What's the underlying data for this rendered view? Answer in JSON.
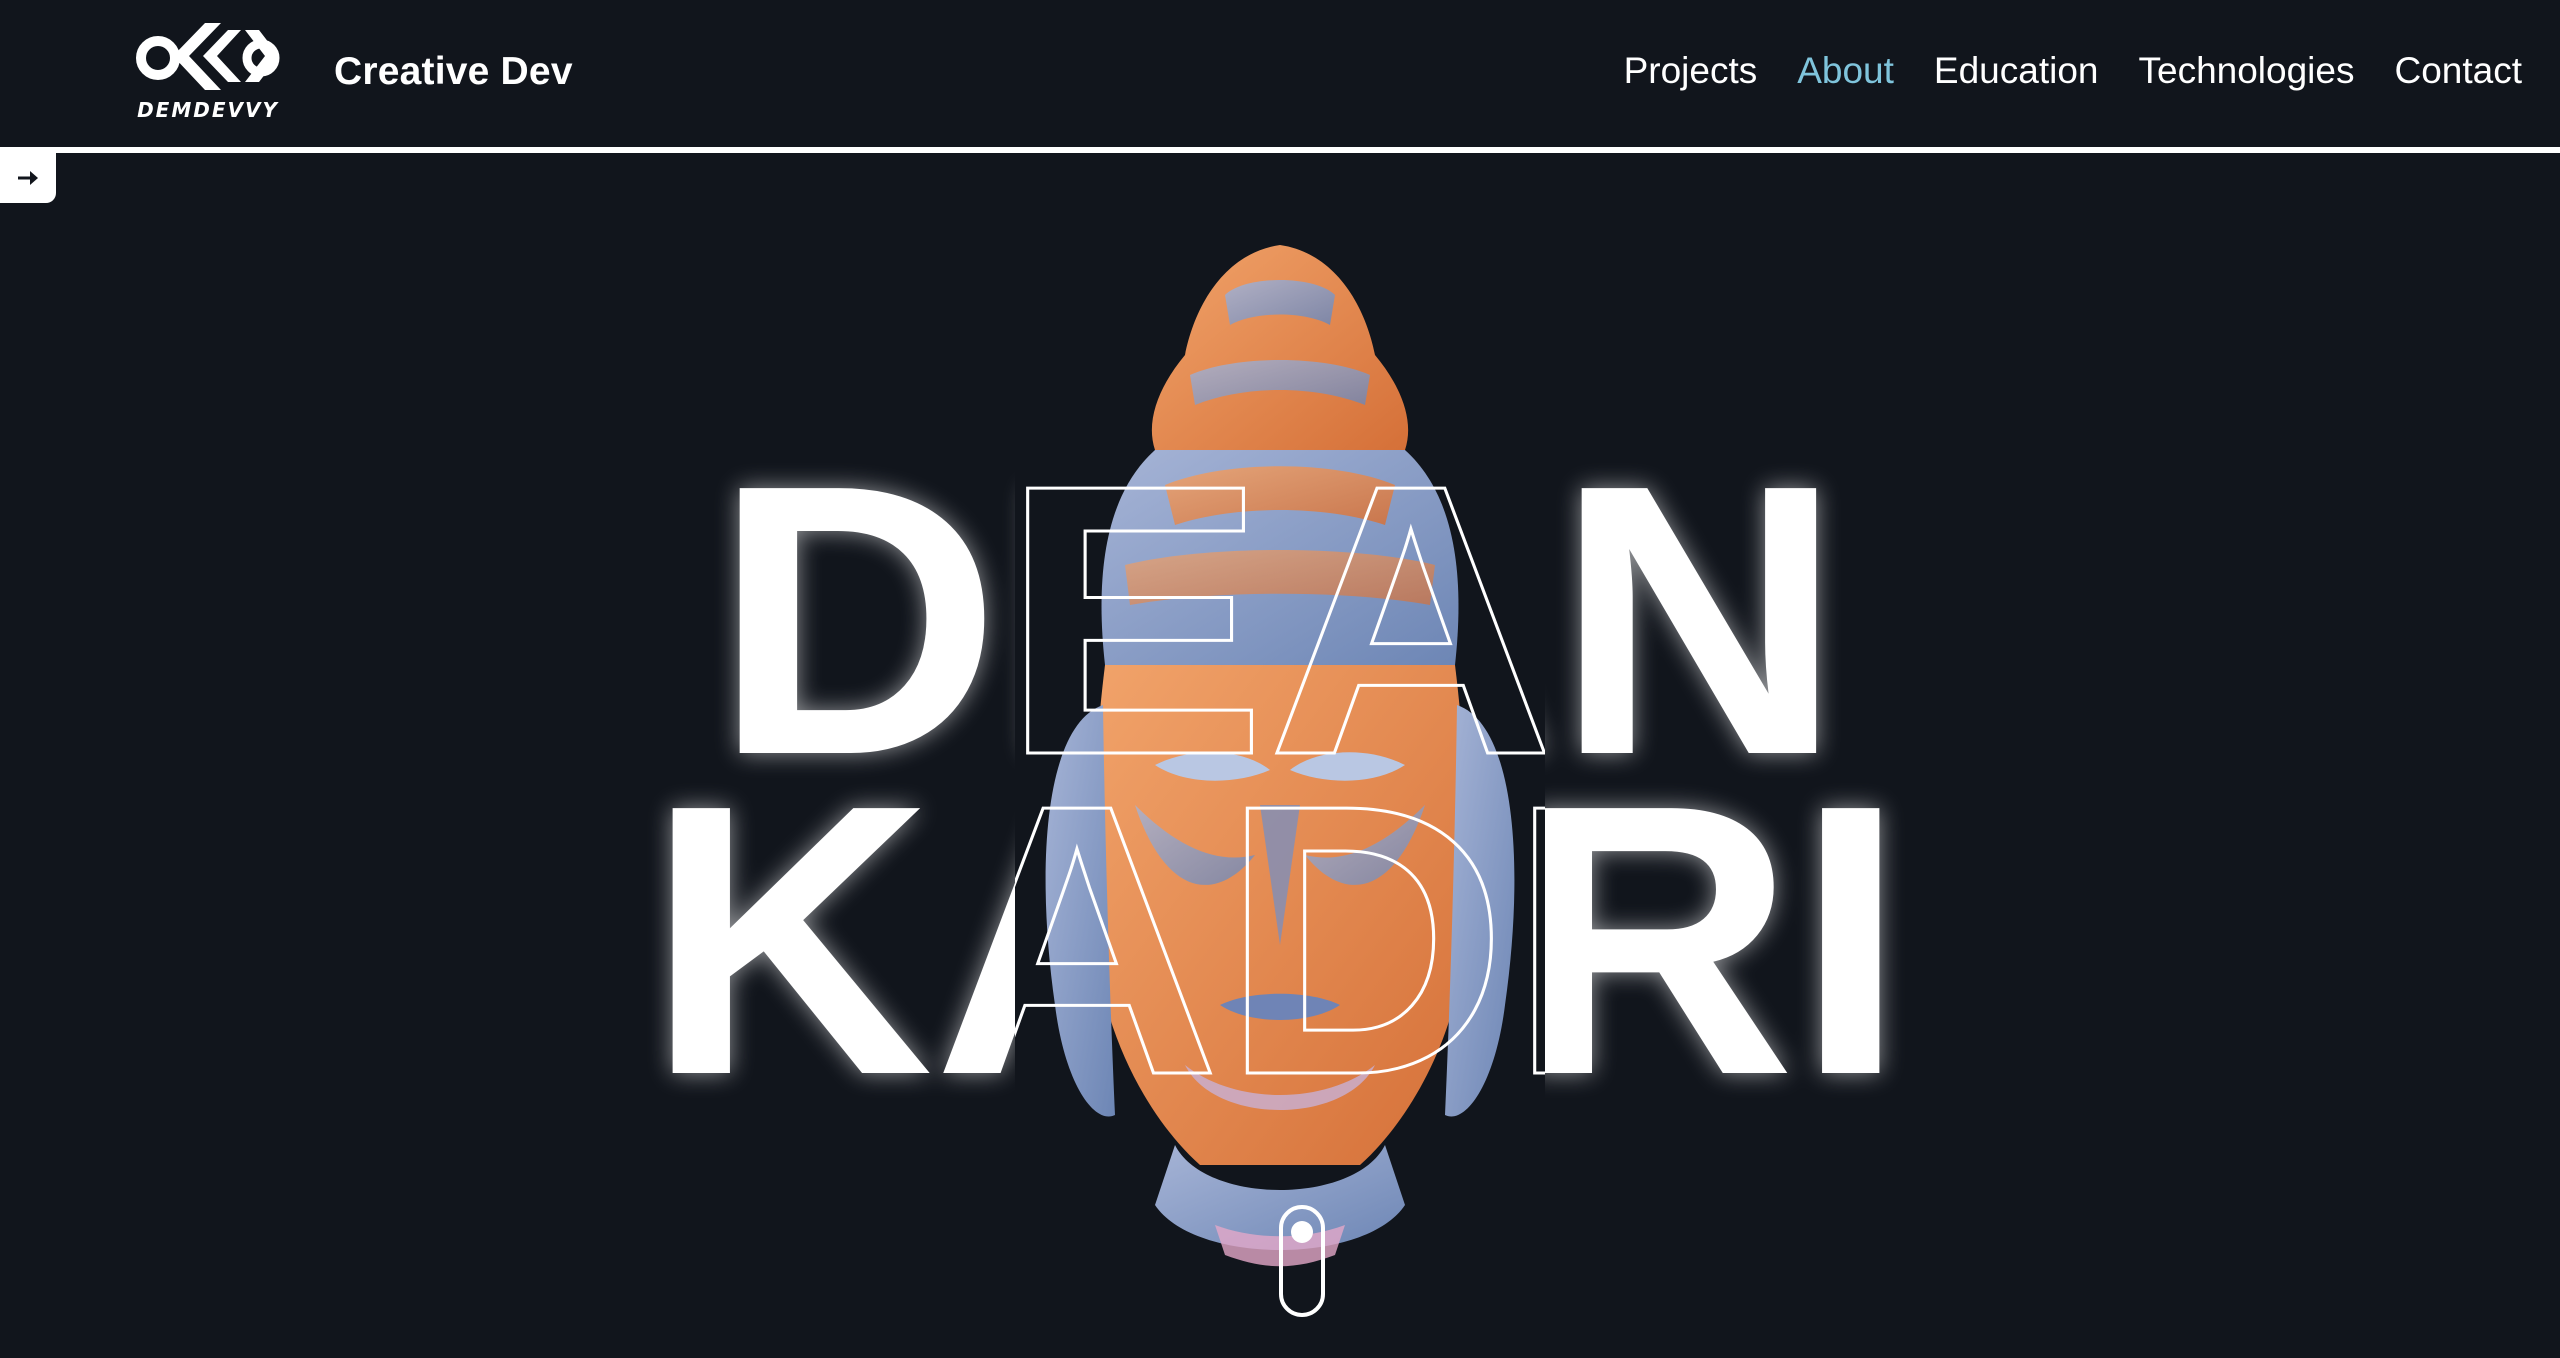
{
  "header": {
    "logo_text": "DEMDEVVY",
    "brand": "Creative Dev",
    "nav": [
      {
        "label": "Projects",
        "active": false
      },
      {
        "label": "About",
        "active": true
      },
      {
        "label": "Education",
        "active": false
      },
      {
        "label": "Technologies",
        "active": false
      },
      {
        "label": "Contact",
        "active": false
      }
    ]
  },
  "sidebar": {
    "toggle_icon": "arrow-right-icon"
  },
  "hero": {
    "first_name": "DEAN",
    "last_name": "KADRI",
    "image": "buddha-head-statue",
    "scroll_icon": "mouse-scroll-icon"
  },
  "colors": {
    "background": "#11151c",
    "accent": "#7fc4dc",
    "text": "#ffffff",
    "statue_orange": "#e98a4d",
    "statue_blue": "#8ea4c8"
  }
}
